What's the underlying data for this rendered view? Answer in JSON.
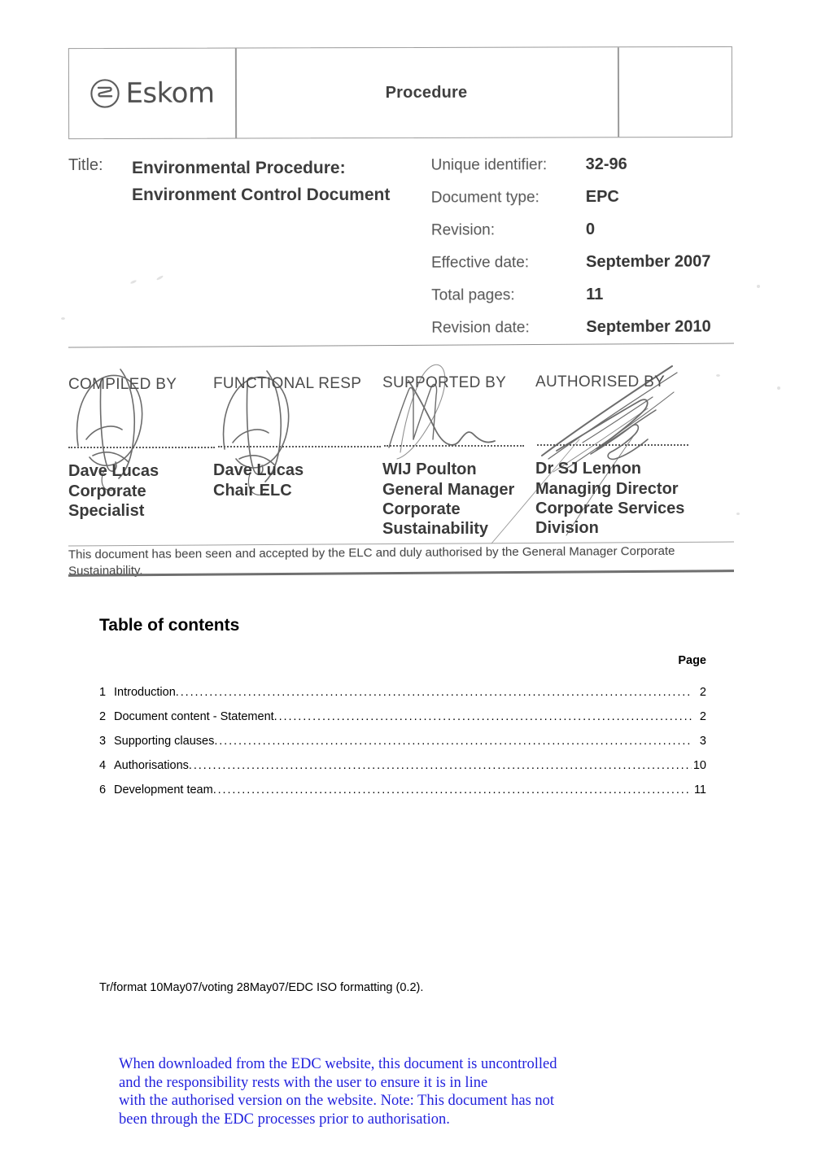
{
  "header_table": {
    "logo_text": "Eskom",
    "logo_icon": "eskom-circular-logo-icon",
    "doc_class": "Procedure"
  },
  "metadata": {
    "title_label": "Title:",
    "title_line1": "Environmental Procedure:",
    "title_line2": "Environment Control Document",
    "fields": [
      {
        "label": "Unique identifier:",
        "value": "32-96"
      },
      {
        "label": "Document type:",
        "value": "EPC"
      },
      {
        "label": "Revision:",
        "value": "0"
      },
      {
        "label": "Effective date:",
        "value": "September 2007"
      },
      {
        "label": "Total pages:",
        "value": "11"
      },
      {
        "label": "Revision date:",
        "value": "September 2010"
      }
    ]
  },
  "signatures": {
    "columns": [
      {
        "heading": "COMPILED BY",
        "name": "Dave Lucas",
        "role": "Corporate\nSpecialist"
      },
      {
        "heading": "FUNCTIONAL RESP",
        "name": "Dave Lucas",
        "role": "Chair ELC"
      },
      {
        "heading": "SUPPORTED BY",
        "name": "WIJ Poulton",
        "role": "General Manager\nCorporate\nSustainability"
      },
      {
        "heading": "AUTHORISED BY",
        "name": "Dr SJ Lennon",
        "role": "Managing Director\nCorporate Services\nDivision"
      }
    ],
    "acceptance_note": "This document has been seen and accepted by the ELC and duly authorised by the General Manager Corporate Sustainability."
  },
  "toc": {
    "heading": "Table of contents",
    "page_column_label": "Page",
    "entries": [
      {
        "num": "1",
        "label": "Introduction",
        "page": "2"
      },
      {
        "num": "2",
        "label": "Document content - Statement",
        "page": "2"
      },
      {
        "num": "3",
        "label": "Supporting clauses",
        "page": "3"
      },
      {
        "num": "4",
        "label": "Authorisations",
        "page": "10"
      },
      {
        "num": "6",
        "label": "Development team",
        "page": "11"
      }
    ]
  },
  "footer": {
    "format_note": "Tr/format 10May07/voting 28May07/EDC ISO formatting (0.2)."
  },
  "disclaimer": {
    "color": "#2222dd",
    "line1": "When downloaded from the EDC website, this document is uncontrolled",
    "line2": "and the responsibility rests with the user to ensure it is in line",
    "line3": "with the authorised version on the website.   Note: This document has not",
    "line4": "been through the EDC processes prior to authorisation."
  }
}
